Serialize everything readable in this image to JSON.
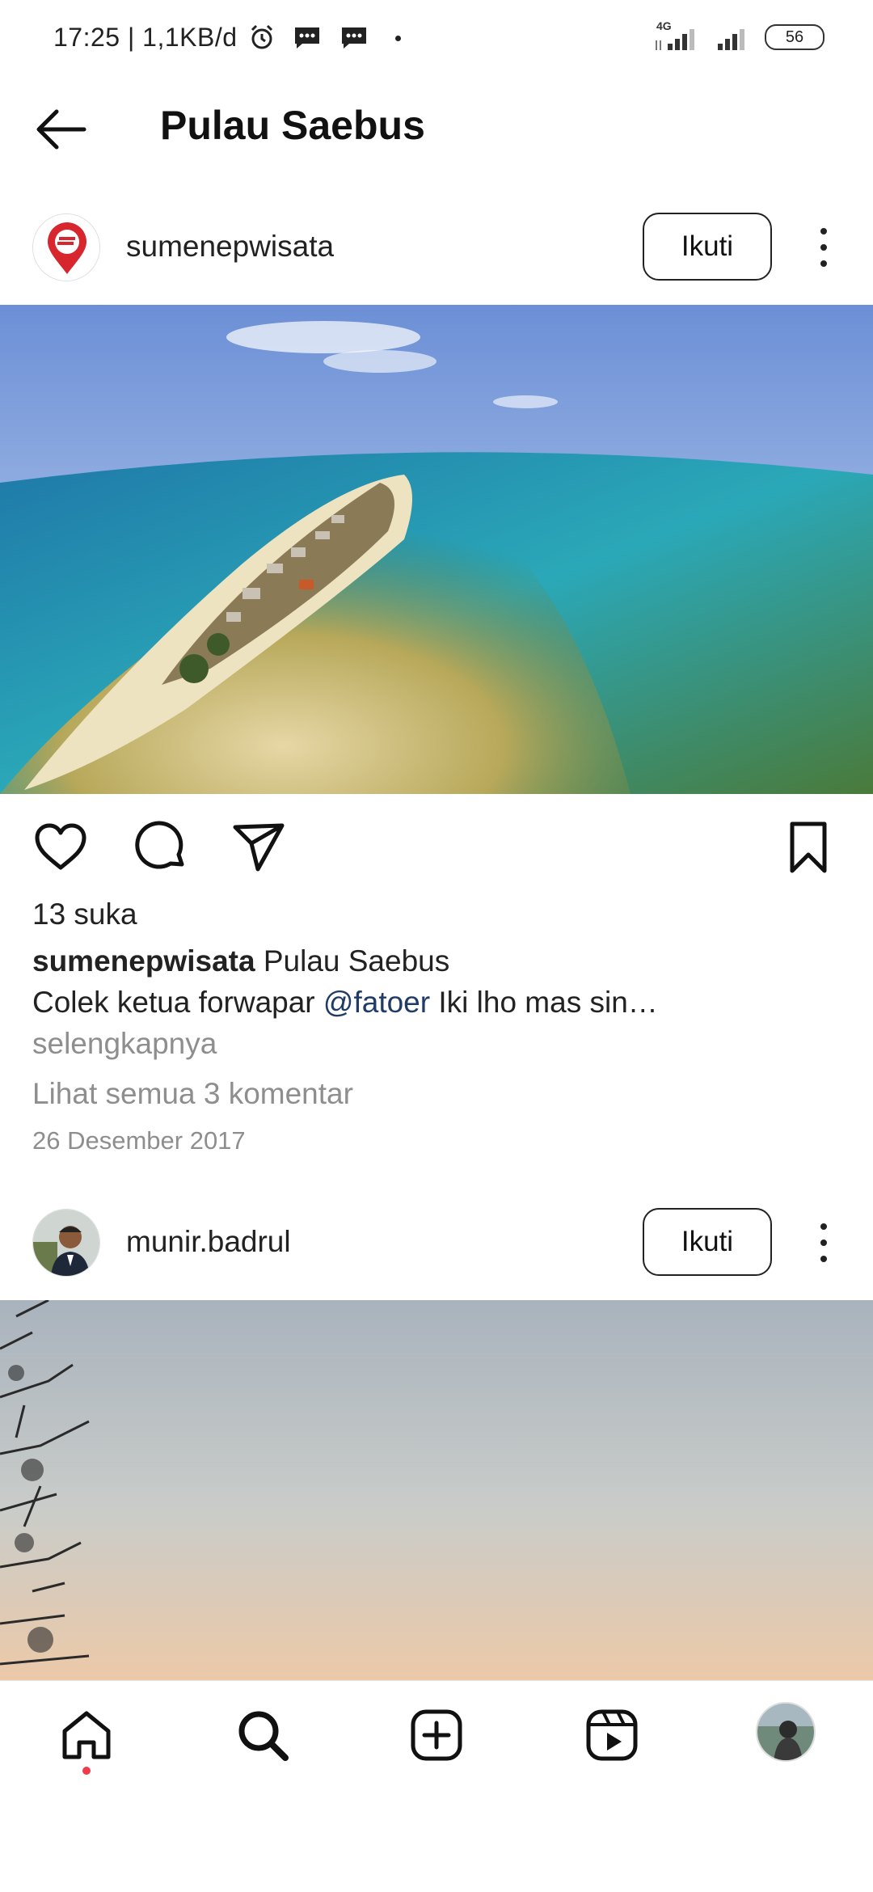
{
  "status_bar": {
    "time_speed": "17:25 | 1,1KB/d",
    "network": "4G",
    "battery": "56"
  },
  "header": {
    "title": "Pulau Saebus"
  },
  "posts": [
    {
      "username": "sumenepwisata",
      "follow_label": "Ikuti",
      "likes": "13 suka",
      "caption_user": "sumenepwisata",
      "caption_title": " Pulau Saebus",
      "caption_text_before": "Colek ketua forwapar ",
      "caption_mention": "@fatoer",
      "caption_text_after": " Iki lho mas sin…",
      "more_label": "selengkapnya",
      "comments_label": "Lihat semua 3 komentar",
      "date": "26 Desember 2017"
    },
    {
      "username": "munir.badrul",
      "follow_label": "Ikuti"
    }
  ],
  "colors": {
    "mention": "#1f3b66",
    "secondary_text": "#8e8e8e",
    "notification_dot": "#ef3b4a",
    "brand_red": "#d7262e"
  },
  "icons": {
    "back": "arrow-left-icon",
    "like": "heart-icon",
    "comment": "comment-icon",
    "share": "send-icon",
    "save": "bookmark-icon",
    "more": "more-vertical-icon",
    "nav": [
      "home-icon",
      "search-icon",
      "create-icon",
      "reels-icon",
      "profile-avatar"
    ]
  }
}
